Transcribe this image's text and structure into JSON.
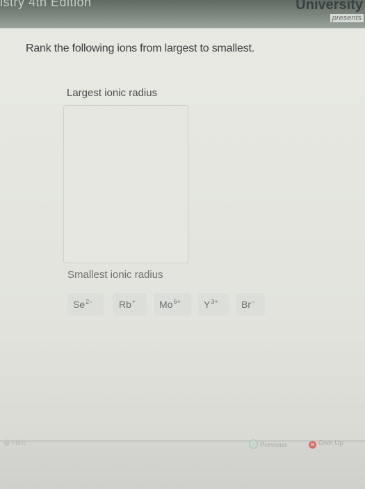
{
  "header": {
    "book_title": "istry 4th Edition",
    "university": "University",
    "presents": "presents"
  },
  "question": {
    "prompt": "Rank the following ions from largest to smallest.",
    "top_label": "Largest ionic radius",
    "bottom_label": "Smallest ionic radius"
  },
  "ions": [
    {
      "symbol": "Se",
      "charge": "2–"
    },
    {
      "symbol": "Rb",
      "charge": "+"
    },
    {
      "symbol": "Mo",
      "charge": "6+"
    },
    {
      "symbol": "Y",
      "charge": "3+"
    },
    {
      "symbol": "Br",
      "charge": "–"
    }
  ],
  "footer": {
    "hint": "Hint",
    "previous": "Previous",
    "give_up": "Give Up"
  }
}
